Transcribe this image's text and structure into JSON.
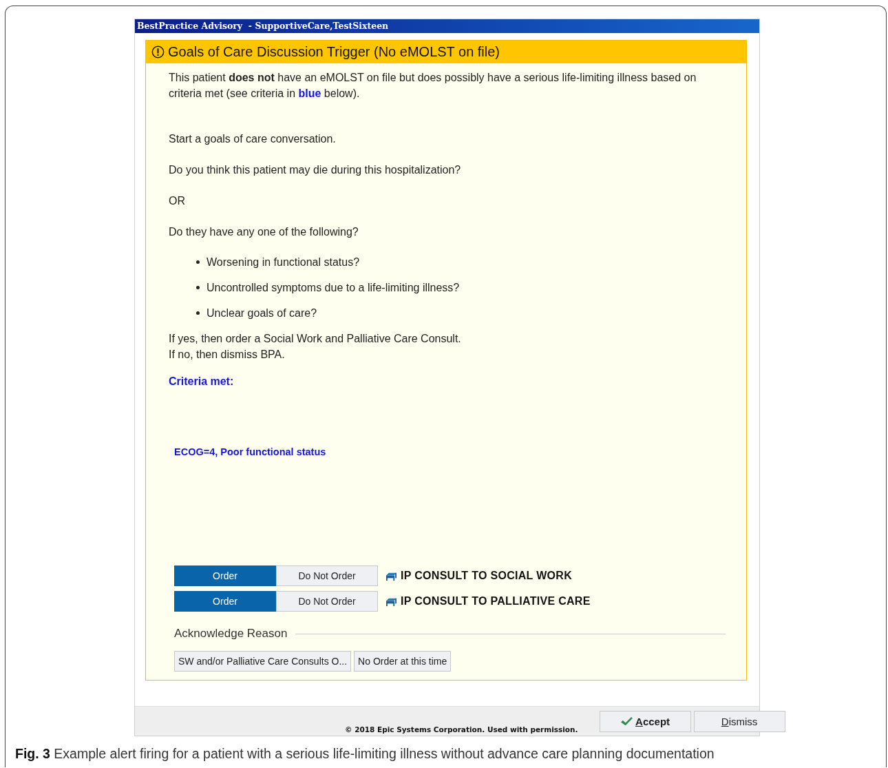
{
  "window": {
    "title": "BestPractice Advisory  - SupportiveCare,TestSixteen"
  },
  "advisory": {
    "title": "Goals of Care Discussion Trigger (No eMOLST on file)",
    "intro": "This patient **does not** have an eMOLST on file but does possibly have a serious life-limiting illness based on criteria met (see criteria in **blue** below).",
    "paragraphs": [
      "Start a goals of care conversation.",
      "Do you think this patient may die during this hospitalization?",
      "OR",
      "Do they have any one of the following?"
    ],
    "bullets": [
      "Worsening in functional status?",
      "Uncontrolled symptoms due to a life-limiting illness?",
      "Unclear goals of care?"
    ],
    "instructions": [
      "If yes, then order a Social Work and Palliative Care Consult.",
      "If no, then dismiss BPA."
    ],
    "criteria_heading": "Criteria met:",
    "criteria": [
      "ECOG=4, Poor functional status"
    ],
    "orders": [
      {
        "name": "IP CONSULT TO SOCIAL WORK",
        "options": [
          {
            "label": "Order",
            "selected": true
          },
          {
            "label": "Do Not Order",
            "selected": false
          }
        ]
      },
      {
        "name": "IP CONSULT TO PALLIATIVE CARE",
        "options": [
          {
            "label": "Order",
            "selected": true
          },
          {
            "label": "Do Not Order",
            "selected": false
          }
        ]
      }
    ],
    "acknowledge": {
      "label": "Acknowledge Reason",
      "reasons": [
        {
          "label": "SW and/or Palliative Care Consults O...",
          "selected": false
        },
        {
          "label": "No Order at this time",
          "selected": false
        }
      ]
    }
  },
  "footer": {
    "copyright": "© 2018 Epic Systems Corporation. Used with permission.",
    "buttons": [
      {
        "label": "Accept",
        "kind": "accept",
        "underline_first": true
      },
      {
        "label": "Dismiss",
        "kind": "dismiss",
        "underline_first": true
      }
    ]
  },
  "caption": "**Fig. 3** Example alert firing for a patient with a serious life-limiting illness without advance care planning documentation"
}
